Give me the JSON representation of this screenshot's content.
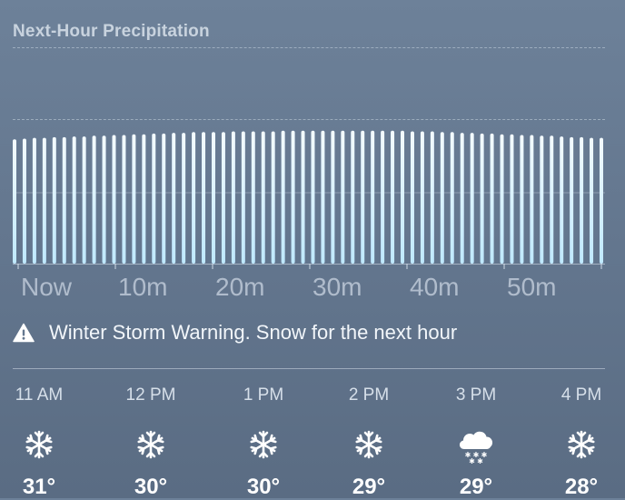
{
  "precipitation": {
    "title": "Next-Hour Precipitation",
    "time_labels": [
      "Now",
      "10m",
      "20m",
      "30m",
      "40m",
      "50m"
    ],
    "alert_icon": "warning-triangle-icon",
    "alert_text": "Winter Storm Warning. Snow for the next hour",
    "bar_color": "#bfe9ff",
    "intensity": [
      0.86,
      0.865,
      0.87,
      0.87,
      0.875,
      0.875,
      0.88,
      0.88,
      0.885,
      0.885,
      0.89,
      0.89,
      0.895,
      0.895,
      0.9,
      0.9,
      0.905,
      0.905,
      0.91,
      0.91,
      0.91,
      0.91,
      0.915,
      0.915,
      0.915,
      0.915,
      0.915,
      0.92,
      0.92,
      0.92,
      0.92,
      0.92,
      0.92,
      0.92,
      0.92,
      0.92,
      0.92,
      0.92,
      0.92,
      0.92,
      0.915,
      0.915,
      0.915,
      0.91,
      0.91,
      0.905,
      0.905,
      0.9,
      0.9,
      0.895,
      0.895,
      0.89,
      0.89,
      0.885,
      0.885,
      0.88,
      0.875,
      0.875,
      0.87,
      0.87
    ]
  },
  "hourly": [
    {
      "time": "11 AM",
      "icon": "snowflake-icon",
      "temp": "31°"
    },
    {
      "time": "12 PM",
      "icon": "snowflake-icon",
      "temp": "30°"
    },
    {
      "time": "1 PM",
      "icon": "snowflake-icon",
      "temp": "30°"
    },
    {
      "time": "2 PM",
      "icon": "snowflake-icon",
      "temp": "29°"
    },
    {
      "time": "3 PM",
      "icon": "cloud-snow-icon",
      "temp": "29°"
    },
    {
      "time": "4 PM",
      "icon": "snowflake-icon",
      "temp": "28°"
    }
  ]
}
